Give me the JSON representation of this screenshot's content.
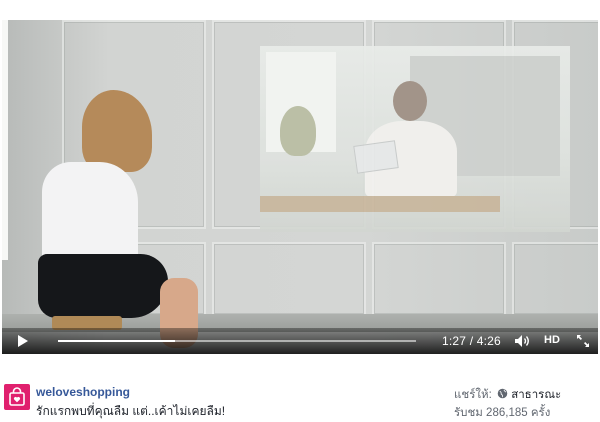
{
  "video": {
    "current_time": "1:27",
    "total_time": "4:26",
    "time_display": "1:27 / 4:26",
    "progress_fraction": 0.327,
    "quality_label": "HD"
  },
  "post": {
    "page_name": "weloveshopping",
    "caption": "รักแรกพบที่คุณลืม แต่..เค้าไม่เคยลืม!",
    "share_label": "แชร์ให้:",
    "audience_label": "สาธารณะ",
    "views_text": "รับชม 286,185 ครั้ง"
  },
  "colors": {
    "brand": "#e0206e",
    "link": "#365899"
  },
  "icons": {
    "play": "play-icon",
    "volume": "volume-icon",
    "fullscreen": "fullscreen-icon",
    "globe": "globe-icon",
    "logo": "shopping-bag-heart-icon"
  }
}
